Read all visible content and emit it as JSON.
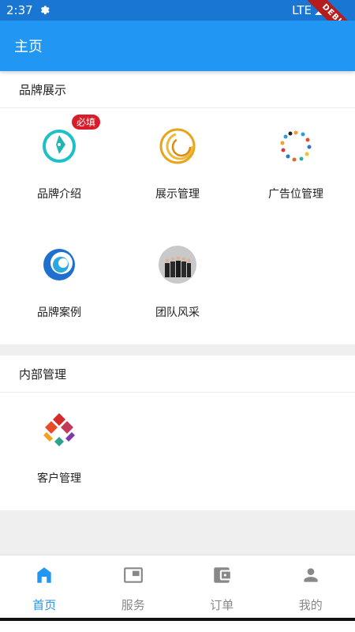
{
  "status_bar": {
    "time": "2:37",
    "network": "LTE"
  },
  "debug_ribbon": "DEBUG",
  "app_bar": {
    "title": "主页"
  },
  "brand_section": {
    "title": "品牌展示",
    "items": [
      {
        "label": "品牌介绍",
        "icon": "pen-circle-icon",
        "badge": "必填"
      },
      {
        "label": "展示管理",
        "icon": "gold-rings-icon"
      },
      {
        "label": "广告位管理",
        "icon": "dot-ring-icon"
      },
      {
        "label": "品牌案例",
        "icon": "blue-swirl-icon"
      },
      {
        "label": "团队风采",
        "icon": "team-photo-icon"
      }
    ]
  },
  "internal_section": {
    "title": "内部管理",
    "items": [
      {
        "label": "客户管理",
        "icon": "colorful-diamond-logo-icon"
      }
    ]
  },
  "bottom_nav": {
    "items": [
      {
        "label": "首页",
        "icon": "home-icon",
        "active": true
      },
      {
        "label": "服务",
        "icon": "picture-in-picture-icon",
        "active": false
      },
      {
        "label": "订单",
        "icon": "wallet-icon",
        "active": false
      },
      {
        "label": "我的",
        "icon": "person-icon",
        "active": false
      }
    ]
  },
  "colors": {
    "primary": "#2196f3",
    "status_bar": "#1976d2",
    "badge": "#d91c2a",
    "inactive": "#888888"
  }
}
